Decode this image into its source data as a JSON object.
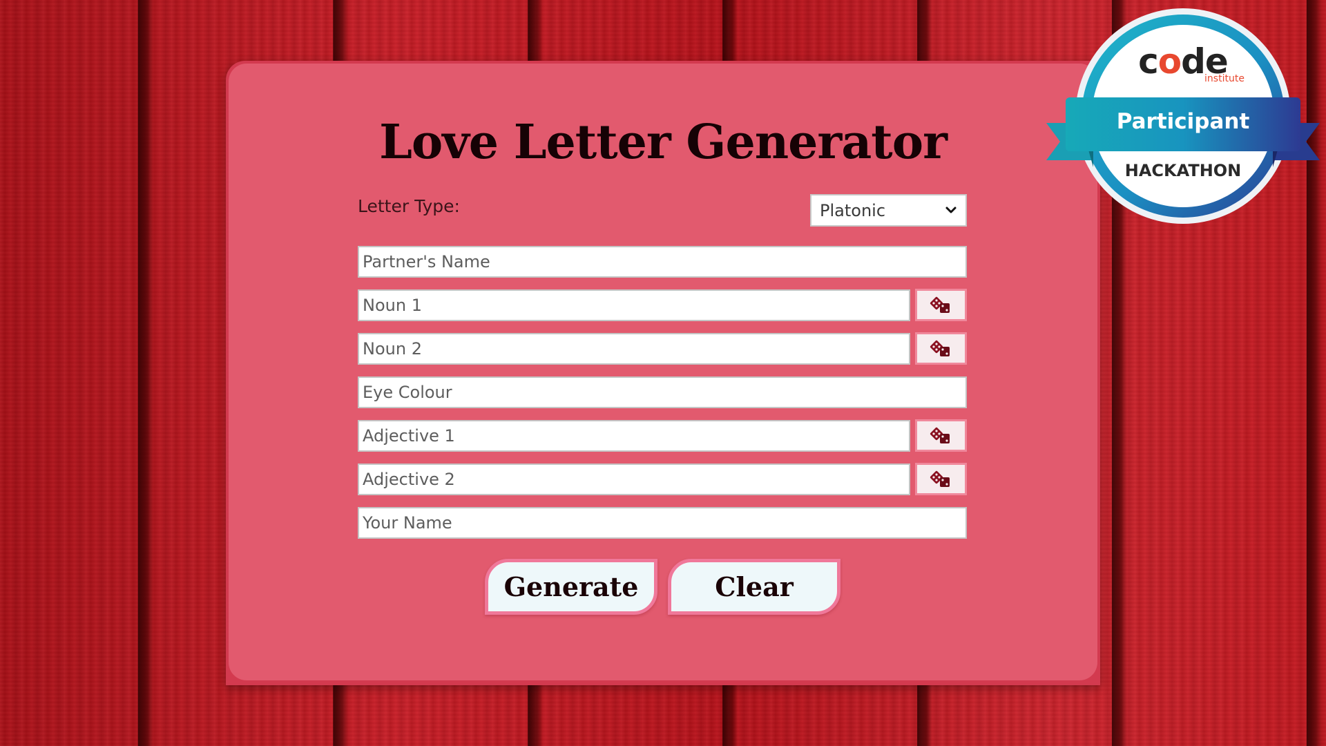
{
  "app": {
    "title": "Love Letter Generator"
  },
  "letter_type": {
    "label": "Letter Type:",
    "selected": "Platonic"
  },
  "fields": {
    "partner_name": "Partner's Name",
    "noun1": "Noun 1",
    "noun2": "Noun 2",
    "eye_colour": "Eye Colour",
    "adjective1": "Adjective 1",
    "adjective2": "Adjective 2",
    "your_name": "Your Name"
  },
  "buttons": {
    "generate": "Generate",
    "clear": "Clear"
  },
  "badge": {
    "brand_part1": "c",
    "brand_o": "o",
    "brand_part2": "de",
    "brand_sub": "institute",
    "ribbon": "Participant",
    "event": "HACKATHON"
  },
  "icons": {
    "dice": "dice-icon",
    "select_chevron": "chevron-down-icon"
  },
  "colors": {
    "card": "#e25a6e",
    "button_border": "#f0789a",
    "dice": "#8a1020",
    "badge_ribbon": "#16a3b8"
  }
}
